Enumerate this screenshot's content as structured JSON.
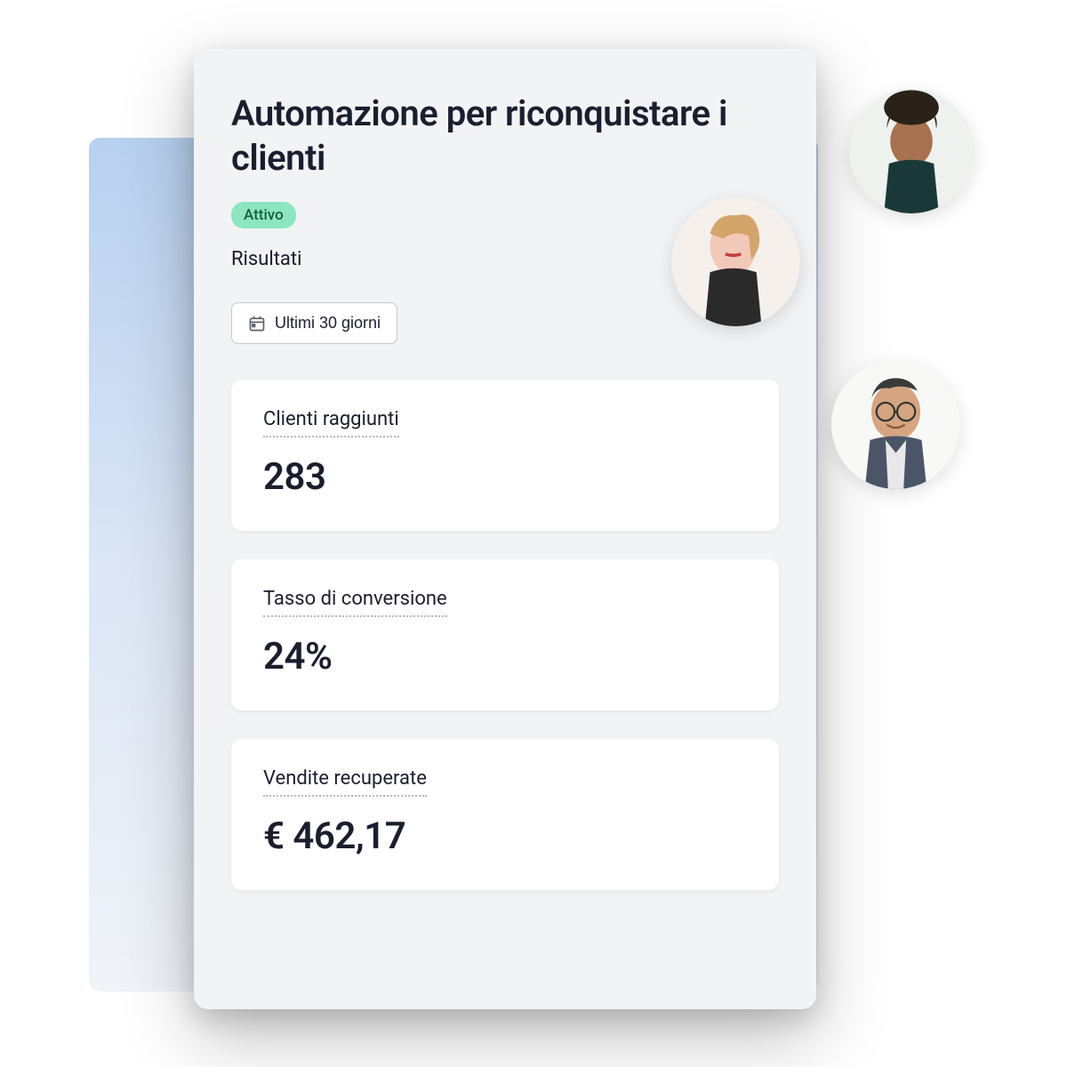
{
  "header": {
    "title": "Automazione per riconquistare i clienti",
    "status": "Attivo",
    "section_label": "Risultati"
  },
  "filter": {
    "date_range": "Ultimi 30 giorni"
  },
  "metrics": [
    {
      "label": "Clienti raggiunti",
      "value": "283"
    },
    {
      "label": "Tasso di conversione",
      "value": "24%"
    },
    {
      "label": "Vendite recuperate",
      "value": "€ 462,17"
    }
  ]
}
